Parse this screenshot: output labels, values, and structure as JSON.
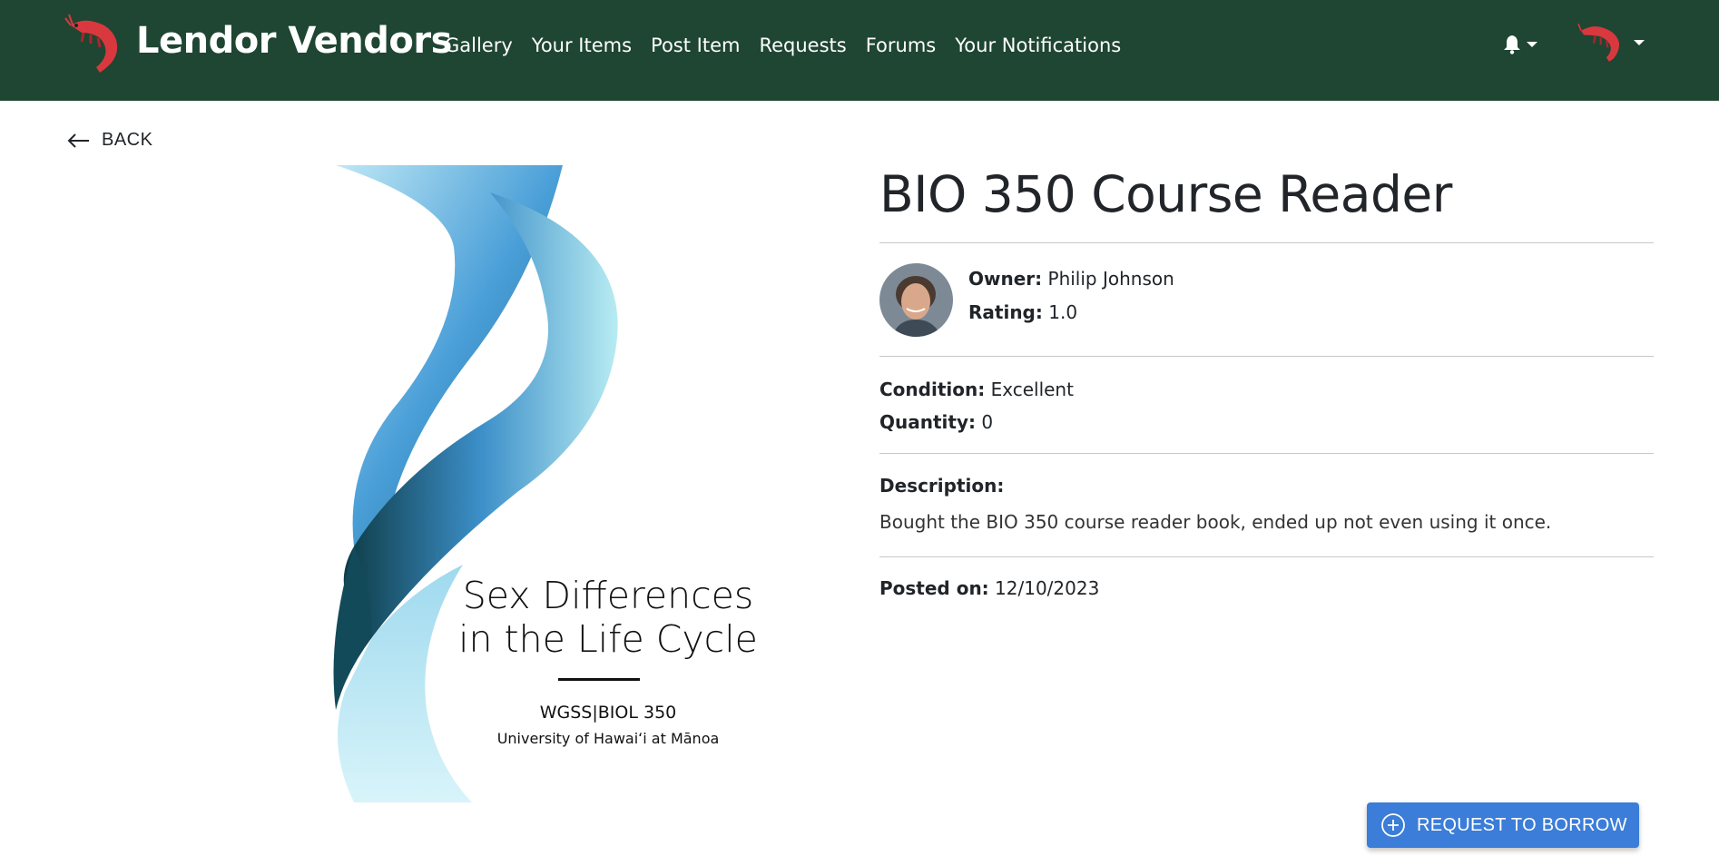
{
  "navbar": {
    "brand": "Lendor Vendors",
    "links": [
      "Gallery",
      "Your Items",
      "Post Item",
      "Requests",
      "Forums",
      "Your Notifications"
    ],
    "colors": {
      "background": "#1e4632",
      "text": "#ffffff"
    }
  },
  "back": {
    "label": "BACK"
  },
  "cover": {
    "title_line1": "Sex Differences",
    "title_line2": "in the Life Cycle",
    "course_code": "WGSS|BIOL 350",
    "university": "University of Hawaiʻi at Mānoa"
  },
  "item": {
    "title": "BIO 350 Course Reader",
    "owner_label": "Owner:",
    "owner_value": "Philip Johnson",
    "rating_label": "Rating:",
    "rating_value": "1.0",
    "condition_label": "Condition:",
    "condition_value": "Excellent",
    "quantity_label": "Quantity:",
    "quantity_value": "0",
    "description_label": "Description:",
    "description": "Bought the BIO 350 course reader book, ended up not even using it once.",
    "posted_label": "Posted on:",
    "posted_value": "12/10/2023"
  },
  "actions": {
    "borrow_label": "REQUEST TO BORROW",
    "borrow_color": "#3b7dd8"
  },
  "icons": [
    "shrimp-logo-icon",
    "bell-icon",
    "arrow-left-icon",
    "plus-circle-icon"
  ]
}
